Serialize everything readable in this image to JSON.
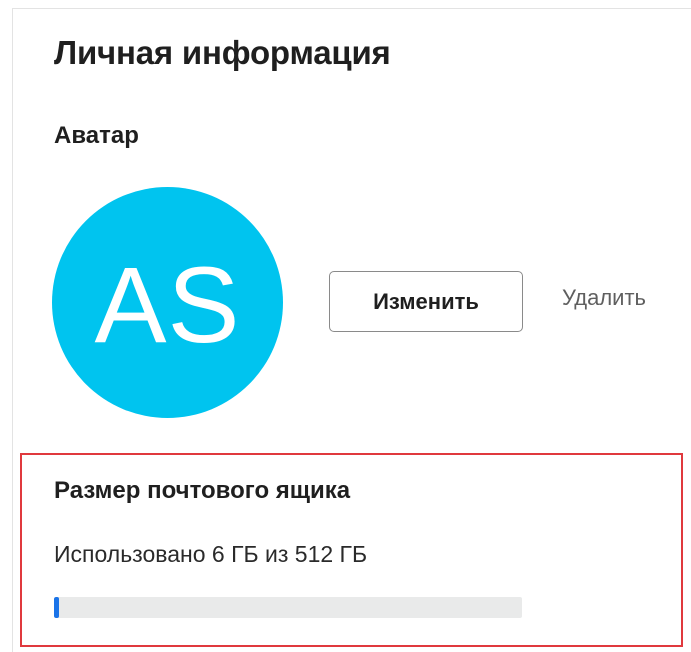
{
  "personal_info": {
    "title": "Личная информация",
    "avatar_section": {
      "heading": "Аватар",
      "initials": "AS",
      "avatar_color": "#00c4ef",
      "change_label": "Изменить",
      "delete_label": "Удалить"
    },
    "mailbox": {
      "heading": "Размер почтового ящика",
      "usage_text": "Использовано 6 ГБ из 512 ГБ",
      "used_gb": 6,
      "total_gb": 512,
      "bar_color": "#1a73e8",
      "highlight_color": "#e0393e"
    }
  }
}
